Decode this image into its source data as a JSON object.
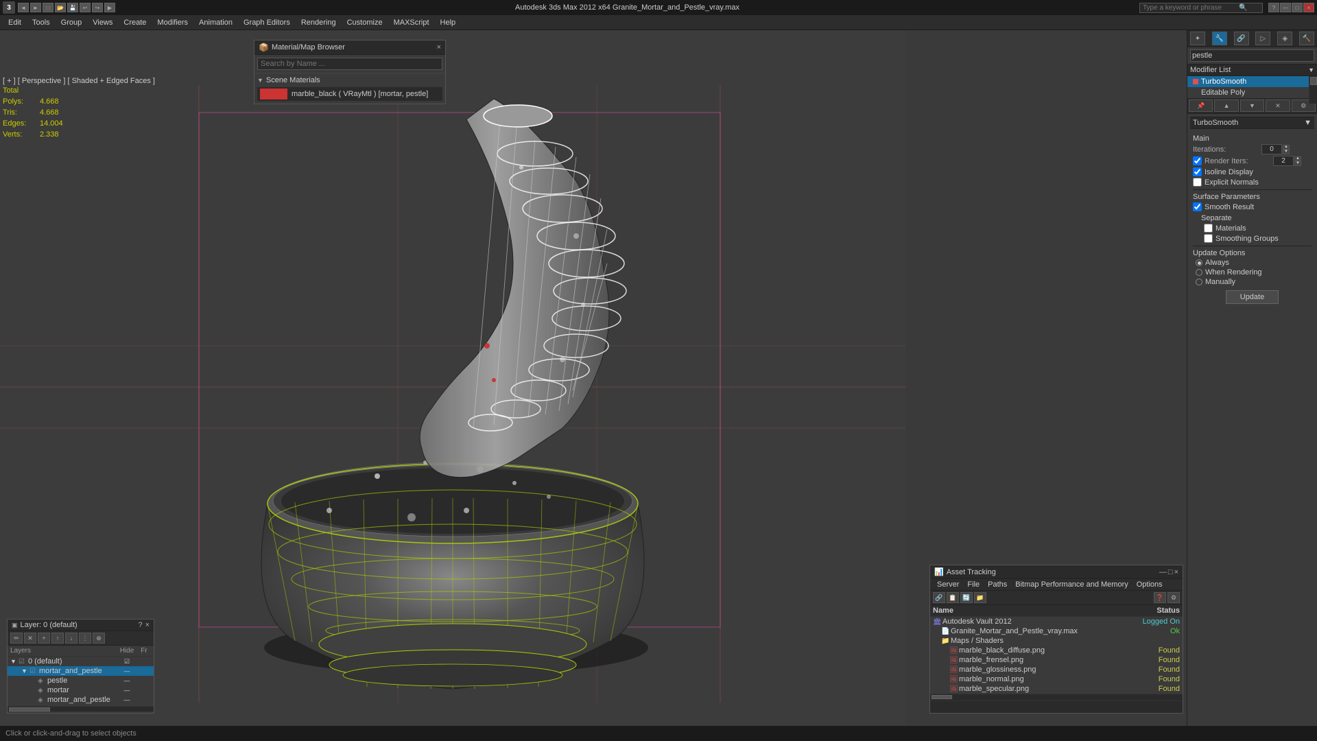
{
  "titlebar": {
    "app_icon": "3",
    "title": "Autodesk 3ds Max 2012 x64   Granite_Mortar_and_Pestle_vray.max",
    "search_placeholder": "Type a keyword or phrase",
    "wc_minimize": "—",
    "wc_restore": "□",
    "wc_close": "×"
  },
  "menubar": {
    "items": [
      "Edit",
      "Tools",
      "Group",
      "Views",
      "Create",
      "Modifiers",
      "Animation",
      "Graph Editors",
      "Rendering",
      "Customize",
      "MAXScript",
      "Help"
    ]
  },
  "viewport": {
    "label": "[ + ] [ Perspective ] [ Shaded + Edged Faces ]",
    "stats": {
      "polys_label": "Polys:",
      "polys_value": "4.668",
      "tris_label": "Tris:",
      "tris_value": "4.668",
      "edges_label": "Edges:",
      "edges_value": "14.004",
      "verts_label": "Verts:",
      "verts_value": "2.338",
      "total_label": "Total"
    }
  },
  "command_panel": {
    "search_placeholder": "pestle",
    "modifier_list_label": "Modifier List",
    "modifiers": [
      {
        "name": "TurboSmooth",
        "active": true,
        "color": "red"
      },
      {
        "name": "Editable Poly",
        "active": false,
        "color": "none"
      }
    ],
    "nav_buttons": [
      "▲",
      "▼",
      "✕",
      "📋",
      "🔧"
    ],
    "icons": [
      "☆",
      "◉",
      "⊕",
      "⊞",
      "⊡"
    ]
  },
  "turbosmooth": {
    "title": "TurboSmooth",
    "main_label": "Main",
    "iterations_label": "Iterations:",
    "iterations_value": "0",
    "render_iters_label": "Render Iters:",
    "render_iters_value": "2",
    "render_iters_checked": true,
    "isoline_label": "Isoline Display",
    "isoline_checked": true,
    "explicit_normals_label": "Explicit Normals",
    "explicit_normals_checked": false,
    "surface_params_label": "Surface Parameters",
    "smooth_result_label": "Smooth Result",
    "smooth_result_checked": true,
    "separate_label": "Separate",
    "materials_label": "Materials",
    "materials_checked": false,
    "smoothing_groups_label": "Smoothing Groups",
    "smoothing_groups_checked": false,
    "update_options_label": "Update Options",
    "always_label": "Always",
    "always_selected": true,
    "when_rendering_label": "When Rendering",
    "when_rendering_selected": false,
    "manually_label": "Manually",
    "manually_selected": false,
    "update_btn": "Update"
  },
  "material_browser": {
    "title": "Material/Map Browser",
    "close_btn": "×",
    "search_placeholder": "Search by Name ...",
    "scene_materials_label": "Scene Materials",
    "material_item": "marble_black ( VRayMtl ) [mortar, pestle]"
  },
  "layers_panel": {
    "title": "Layer: 0 (default)",
    "help_btn": "?",
    "close_btn": "×",
    "header_name": "Layers",
    "header_hide": "Hide",
    "header_fr": "Fr",
    "layers": [
      {
        "name": "0 (default)",
        "indent": 0,
        "expanded": true,
        "checked": true
      },
      {
        "name": "mortar_and_pestle",
        "indent": 1,
        "selected": true
      },
      {
        "name": "pestle",
        "indent": 2
      },
      {
        "name": "mortar",
        "indent": 2
      },
      {
        "name": "mortar_and_pestle",
        "indent": 2
      }
    ]
  },
  "asset_tracking": {
    "title": "Asset Tracking",
    "menus": [
      "Server",
      "File",
      "Paths",
      "Bitmap Performance and Memory",
      "Options"
    ],
    "columns": {
      "name": "Name",
      "status": "Status"
    },
    "assets": [
      {
        "name": "Autodesk Vault 2012",
        "indent": 0,
        "status": "Logged On",
        "status_class": "status-loggedin",
        "icon": "🏛"
      },
      {
        "name": "Granite_Mortar_and_Pestle_vray.max",
        "indent": 1,
        "status": "Ok",
        "status_class": "status-ok",
        "icon": "📄"
      },
      {
        "name": "Maps / Shaders",
        "indent": 1,
        "status": "",
        "icon": "📁"
      },
      {
        "name": "marble_black_diffuse.png",
        "indent": 2,
        "status": "Found",
        "status_class": "status-found",
        "icon": "🖼"
      },
      {
        "name": "marble_frensel.png",
        "indent": 2,
        "status": "Found",
        "status_class": "status-found",
        "icon": "🖼"
      },
      {
        "name": "marble_glossiness.png",
        "indent": 2,
        "status": "Found",
        "status_class": "status-found",
        "icon": "🖼"
      },
      {
        "name": "marble_normal.png",
        "indent": 2,
        "status": "Found",
        "status_class": "status-found",
        "icon": "🖼"
      },
      {
        "name": "marble_specular.png",
        "indent": 2,
        "status": "Found",
        "status_class": "status-found",
        "icon": "🖼"
      }
    ]
  },
  "statusbar": {
    "text": "Click or click-and-drag to select objects"
  }
}
